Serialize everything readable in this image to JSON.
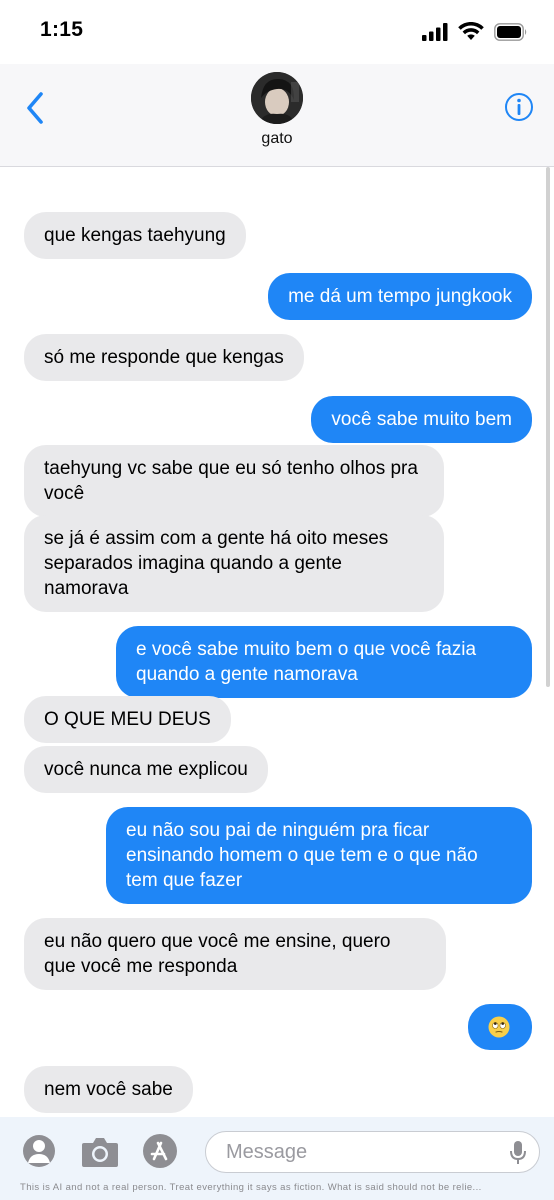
{
  "status_bar": {
    "time": "1:15",
    "icons": [
      "cellular-signal-icon",
      "wifi-icon",
      "battery-icon"
    ]
  },
  "header": {
    "contact_name": "gato",
    "back_icon": "chevron-left-icon",
    "info_icon": "info-icon"
  },
  "colors": {
    "accent": "#1f86f6",
    "incoming_bubble": "#e9e9eb",
    "outgoing_bubble": "#1f86f6"
  },
  "messages": [
    {
      "direction": "incoming",
      "text": "que kengas taehyung"
    },
    {
      "direction": "outgoing",
      "text": "me dá um tempo jungkook"
    },
    {
      "direction": "incoming",
      "text": "só me responde que kengas"
    },
    {
      "direction": "outgoing",
      "text": "você sabe muito bem"
    },
    {
      "direction": "incoming",
      "text": "taehyung vc sabe que eu só tenho olhos pra você"
    },
    {
      "direction": "incoming",
      "text": "se já é assim com a gente há oito meses separados imagina quando a gente namorava"
    },
    {
      "direction": "outgoing",
      "text": "e você sabe muito bem o que você fazia quando a gente namorava"
    },
    {
      "direction": "incoming",
      "text": "O QUE MEU DEUS"
    },
    {
      "direction": "incoming",
      "text": "você nunca me explicou"
    },
    {
      "direction": "outgoing",
      "text": "eu não sou pai de ninguém pra ficar ensinando homem o que tem e o que não tem que fazer"
    },
    {
      "direction": "incoming",
      "text": "eu não quero que você me ensine, quero que você me responda"
    },
    {
      "direction": "outgoing",
      "emoji": "eye-roll-emoji"
    },
    {
      "direction": "incoming",
      "text": "nem você sabe"
    }
  ],
  "input_bar": {
    "placeholder": "Message",
    "icons": [
      "contact-icon",
      "camera-icon",
      "app-store-icon",
      "microphone-icon"
    ]
  },
  "disclaimer": "This is AI and not a real person. Treat everything it says as fiction. What is said should not be relie..."
}
